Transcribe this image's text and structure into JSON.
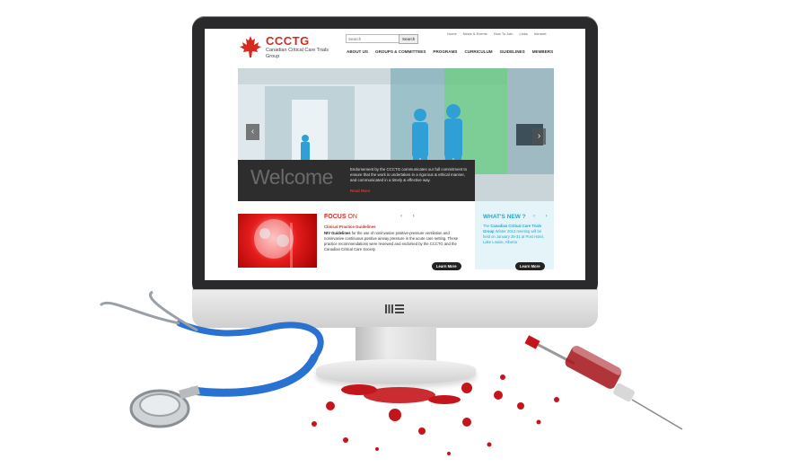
{
  "site": {
    "logo_title": "CCCTG",
    "logo_subtitle": "Canadian Critical Care Trials Group",
    "search_placeholder": "Search",
    "search_button": "Search",
    "util_nav": [
      "Home",
      "News & Events",
      "How To Join",
      "Links",
      "Intranet"
    ],
    "main_nav": [
      "ABOUT US",
      "GROUPS & COMMITTEES",
      "PROGRAMS",
      "CURRICULUM",
      "GUIDELINES",
      "MEMBERS"
    ]
  },
  "hero": {
    "welcome_title": "Welcome",
    "welcome_text": "Endorsement by the CCCTG communicates our full commitment to ensure that the work is undertaken in a rigorous & ethical manner, and communicated in a timely & effective way.",
    "read_more": "Read More",
    "prev_arrow": "‹",
    "next_arrow": "›"
  },
  "focus": {
    "heading_a": "FOCUS",
    "heading_b": "ON",
    "nav": "‹ ›",
    "subheading": "Clinical Practice Guidelines",
    "body_bold": "NIV Guidelines",
    "body_rest": " for the use of noninvasive positive-pressure ventilation and noninvasive continuous positive airway pressure in the acute care setting. These practice recommendations were reviewed and endorsed by the CCCTG and the Canadian Critical Care Society.",
    "learn_more": "Learn More"
  },
  "whats_new": {
    "heading": "WHAT'S NEW ?",
    "nav": "‹ ›",
    "text_a": "The ",
    "text_bold": "Canadian Critical Care Trials Group",
    "text_b": " Winter 2013 meeting will be held on January 29-31 at Post Hotel, Lake Louise, Alberta",
    "learn_more": "Learn More"
  },
  "colors": {
    "brand_red": "#d52b1e",
    "accent_blue": "#2aa6c8"
  }
}
